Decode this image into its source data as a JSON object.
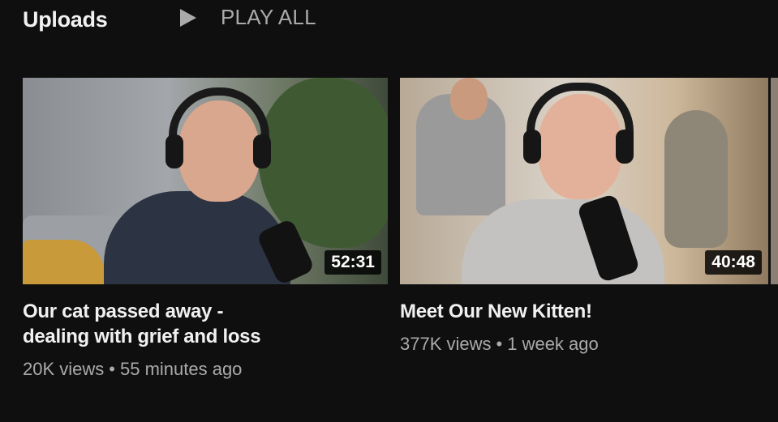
{
  "section": {
    "title": "Uploads",
    "play_all_label": "PLAY ALL"
  },
  "videos": [
    {
      "title_line1": "Our cat passed away -",
      "title_line2": "dealing with grief and loss",
      "duration": "52:31",
      "views": "20K views",
      "age": "55 minutes ago"
    },
    {
      "title_line1": "Meet Our New Kitten!",
      "duration": "40:48",
      "views": "377K views",
      "age": "1 week ago"
    }
  ],
  "colors": {
    "background": "#0f0f0f",
    "primary_text": "#f1f1f1",
    "secondary_text": "#aaaaaa"
  },
  "icons": {
    "play_all": "play-icon"
  }
}
